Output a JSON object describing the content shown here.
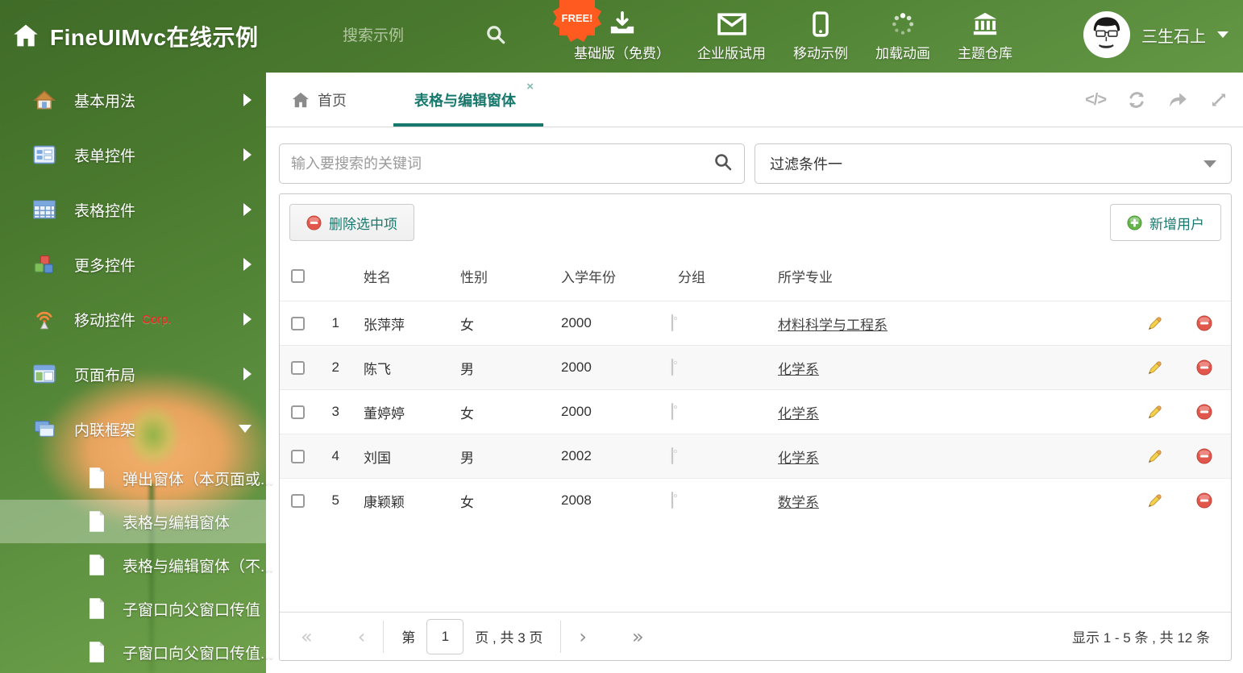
{
  "header": {
    "title": "FineUIMvc在线示例",
    "search_placeholder": "搜索示例",
    "free_badge": "FREE!",
    "nav_items": [
      {
        "label": "基础版（免费）",
        "icon": "download-icon"
      },
      {
        "label": "企业版试用",
        "icon": "envelope-icon"
      },
      {
        "label": "移动示例",
        "icon": "mobile-icon"
      },
      {
        "label": "加载动画",
        "icon": "spinner-icon"
      },
      {
        "label": "主题仓库",
        "icon": "bank-icon"
      }
    ],
    "user": {
      "name": "三生石上"
    }
  },
  "sidebar": {
    "items": [
      {
        "label": "基本用法"
      },
      {
        "label": "表单控件"
      },
      {
        "label": "表格控件"
      },
      {
        "label": "更多控件"
      },
      {
        "label": "移动控件",
        "badge": "Corp."
      },
      {
        "label": "页面布局"
      },
      {
        "label": "内联框架",
        "expanded": true
      }
    ],
    "subitems": [
      {
        "label": "弹出窗体（本页面或..."
      },
      {
        "label": "表格与编辑窗体",
        "selected": true
      },
      {
        "label": "表格与编辑窗体（不..."
      },
      {
        "label": "子窗口向父窗口传值"
      },
      {
        "label": "子窗口向父窗口传值..."
      }
    ]
  },
  "tabs": {
    "home": {
      "label": "首页"
    },
    "active": {
      "label": "表格与编辑窗体",
      "close_glyph": "×"
    },
    "tools": {
      "code_glyph": "</>"
    }
  },
  "filters": {
    "search_placeholder": "输入要搜索的关键词",
    "filter_value": "过滤条件一"
  },
  "grid": {
    "toolbar": {
      "delete_label": "删除选中项",
      "add_label": "新增用户"
    },
    "columns": {
      "name": "姓名",
      "gender": "性别",
      "year": "入学年份",
      "group": "分组",
      "major": "所学专业"
    },
    "rows": [
      {
        "index": 1,
        "name": "张萍萍",
        "gender": "女",
        "year": "2000",
        "tag_color": "#8ec7f1",
        "major": "材料科学与工程系"
      },
      {
        "index": 2,
        "name": "陈飞",
        "gender": "男",
        "year": "2000",
        "tag_color": "#8ec7f1",
        "major": "化学系"
      },
      {
        "index": 3,
        "name": "董婷婷",
        "gender": "女",
        "year": "2000",
        "tag_color": "#9acb6e",
        "major": "化学系"
      },
      {
        "index": 4,
        "name": "刘国",
        "gender": "男",
        "year": "2002",
        "tag_color": "#9acb6e",
        "major": "化学系"
      },
      {
        "index": 5,
        "name": "康颖颖",
        "gender": "女",
        "year": "2008",
        "tag_color": "#f7b267",
        "major": "数学系"
      }
    ],
    "pagination": {
      "first_glyph": "«",
      "prev_glyph": "‹",
      "next_glyph": "›",
      "last_glyph": "»",
      "page_prefix": "第",
      "page_value": "1",
      "page_suffix": "页 , 共 3 页",
      "summary": "显示 1 - 5 条 , 共 12 条"
    }
  },
  "colors": {
    "accent": "#17796d",
    "header_green": "#4a7a2e",
    "free_badge": "#ff5a1f"
  }
}
